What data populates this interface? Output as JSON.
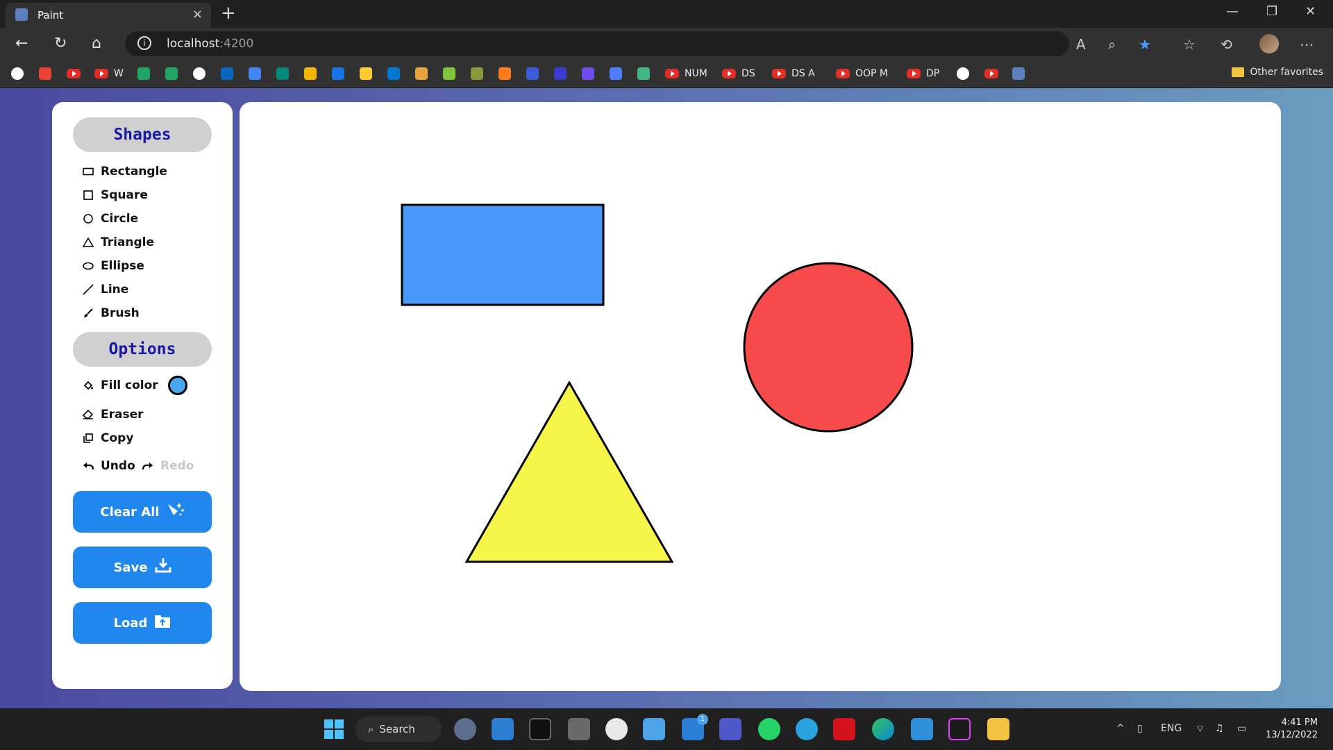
{
  "browser": {
    "tab_title": "Paint",
    "tab_close": "×",
    "new_tab": "+",
    "url_host": "localhost",
    "url_port": ":4200",
    "favorites": [
      {
        "icon": "google-icon",
        "label": ""
      },
      {
        "icon": "gmail-icon",
        "label": ""
      },
      {
        "icon": "youtube-icon",
        "label": ""
      },
      {
        "icon": "youtube-icon",
        "label": "W"
      },
      {
        "icon": "drive-icon",
        "label": ""
      },
      {
        "icon": "drive-icon",
        "label": ""
      },
      {
        "icon": "github-icon",
        "label": ""
      },
      {
        "icon": "linkedin-icon",
        "label": ""
      },
      {
        "icon": "translate-icon",
        "label": ""
      },
      {
        "icon": "meet-icon",
        "label": ""
      },
      {
        "icon": "classroom-icon",
        "label": ""
      },
      {
        "icon": "contacts-icon",
        "label": ""
      },
      {
        "icon": "emoji-icon",
        "label": ""
      },
      {
        "icon": "outlook-icon",
        "label": ""
      },
      {
        "icon": "grid-icon",
        "label": ""
      },
      {
        "icon": "download-icon",
        "label": ""
      },
      {
        "icon": "globe-icon",
        "label": ""
      },
      {
        "icon": "fox-icon",
        "label": ""
      },
      {
        "icon": "shield-icon",
        "label": ""
      },
      {
        "icon": "u-icon",
        "label": ""
      },
      {
        "icon": "bolt-icon",
        "label": ""
      },
      {
        "icon": "circle-dash-icon",
        "label": ""
      },
      {
        "icon": "vue-icon",
        "label": ""
      },
      {
        "icon": "youtube-icon",
        "label": "NUM"
      },
      {
        "icon": "youtube-icon",
        "label": "DS"
      },
      {
        "icon": "youtube-icon",
        "label": "DS A"
      },
      {
        "icon": "youtube-icon",
        "label": "OOP M"
      },
      {
        "icon": "youtube-icon",
        "label": "DP"
      },
      {
        "icon": "google-icon",
        "label": ""
      },
      {
        "icon": "youtube-icon",
        "label": ""
      },
      {
        "icon": "paint-icon",
        "label": ""
      }
    ],
    "other_favorites": "Other favorites"
  },
  "panel": {
    "shapes_heading": "Shapes",
    "shapes": [
      {
        "label": "Rectangle",
        "icon": "rectangle-icon"
      },
      {
        "label": "Square",
        "icon": "square-icon"
      },
      {
        "label": "Circle",
        "icon": "circle-icon"
      },
      {
        "label": "Triangle",
        "icon": "triangle-icon"
      },
      {
        "label": "Ellipse",
        "icon": "ellipse-icon"
      },
      {
        "label": "Line",
        "icon": "line-icon"
      },
      {
        "label": "Brush",
        "icon": "brush-icon"
      }
    ],
    "options_heading": "Options",
    "fill_color_label": "Fill color",
    "fill_color": "#4aa9ee",
    "eraser_label": "Eraser",
    "copy_label": "Copy",
    "undo_label": "Undo",
    "redo_label": "Redo",
    "clear_all_label": "Clear All",
    "save_label": "Save",
    "load_label": "Load"
  },
  "canvas": {
    "shapes": [
      {
        "type": "rectangle",
        "fill": "#4a98f7",
        "stroke": "#000000"
      },
      {
        "type": "circle",
        "fill": "#f74a4a",
        "stroke": "#000000"
      },
      {
        "type": "triangle",
        "fill": "#f5f54a",
        "stroke": "#000000"
      }
    ]
  },
  "taskbar": {
    "search_label": "Search",
    "language": "ENG",
    "time": "4:41 PM",
    "date": "13/12/2022",
    "badge": "1"
  }
}
